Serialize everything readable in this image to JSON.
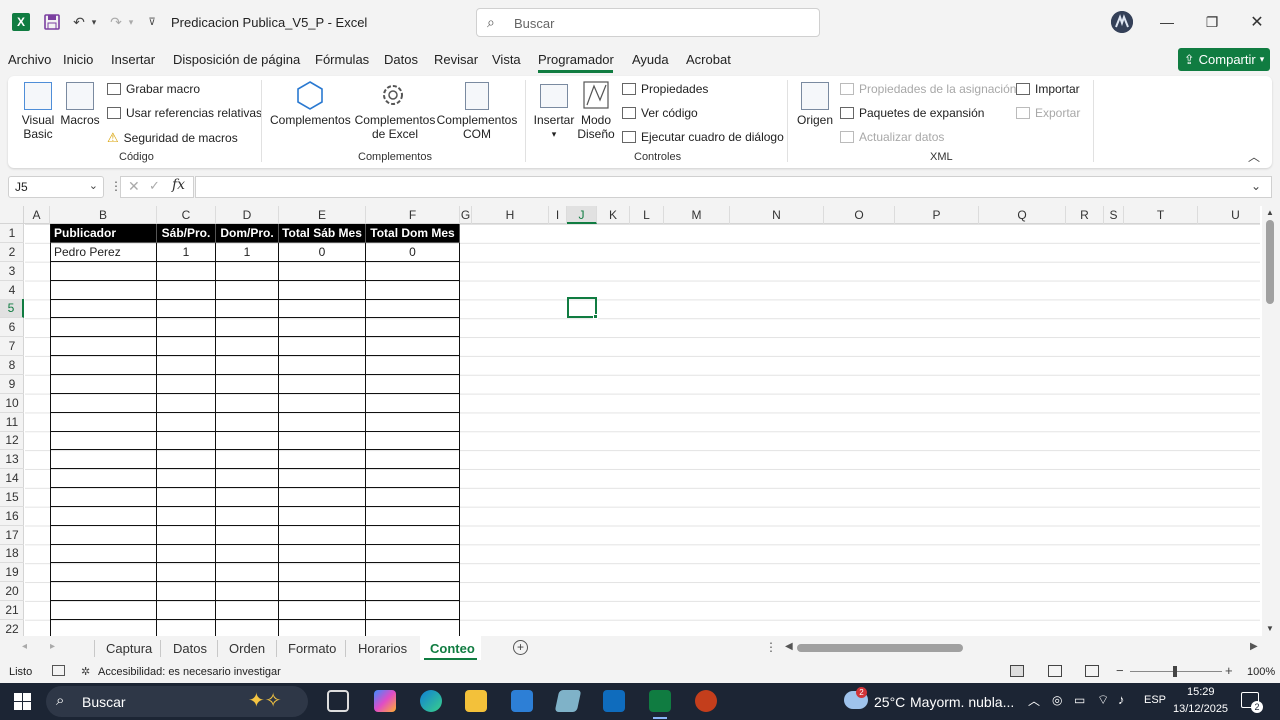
{
  "app": {
    "title": "Predicacion Publica_V5_P  -  Excel",
    "search_placeholder": "Buscar"
  },
  "menu": {
    "tabs": [
      "Archivo",
      "Inicio",
      "Insertar",
      "Disposición de página",
      "Fórmulas",
      "Datos",
      "Revisar",
      "Vista",
      "Programador",
      "Ayuda",
      "Acrobat"
    ],
    "active": "Programador",
    "share_label": "Compartir"
  },
  "ribbon": {
    "codigo": {
      "visual_basic": "Visual\nBasic",
      "macros": "Macros",
      "grabar_macro": "Grabar macro",
      "usar_referencias": "Usar referencias relativas",
      "seguridad": "Seguridad de macros",
      "group": "Código"
    },
    "complementos": {
      "complementos": "Complementos",
      "complementos_excel": "Complementos\nde Excel",
      "complementos_com": "Complementos\nCOM",
      "group": "Complementos"
    },
    "controles": {
      "insertar": "Insertar",
      "modo_diseno": "Modo\nDiseño",
      "propiedades": "Propiedades",
      "ver_codigo": "Ver código",
      "ejecutar": "Ejecutar cuadro de diálogo",
      "group": "Controles"
    },
    "xml": {
      "origen": "Origen",
      "propiedades_asignacion": "Propiedades de la asignación",
      "paquetes": "Paquetes de expansión",
      "actualizar": "Actualizar datos",
      "importar": "Importar",
      "exportar": "Exportar",
      "group": "XML"
    }
  },
  "formula_bar": {
    "name_box": "J5",
    "formula": ""
  },
  "columns": [
    "A",
    "B",
    "C",
    "D",
    "E",
    "F",
    "G",
    "H",
    "I",
    "J",
    "K",
    "L",
    "M",
    "N",
    "O",
    "P",
    "Q",
    "R",
    "S",
    "T",
    "U"
  ],
  "selected_column": "J",
  "selected_row": "5",
  "rows": [
    "1",
    "2",
    "3",
    "4",
    "5",
    "6",
    "7",
    "8",
    "9",
    "10",
    "11",
    "12",
    "13",
    "14",
    "15",
    "16",
    "17",
    "18",
    "19",
    "20",
    "21",
    "22"
  ],
  "table": {
    "headers": [
      "Publicador",
      "Sáb/Pro.",
      "Dom/Pro.",
      "Total Sáb Mes",
      "Total Dom Mes"
    ],
    "data": [
      [
        "Pedro Perez",
        "1",
        "1",
        "0",
        "0"
      ]
    ]
  },
  "sheet_tabs": [
    "Captura",
    "Datos",
    "Orden",
    "Formato",
    "Horarios",
    "Conteo"
  ],
  "active_sheet": "Conteo",
  "status": {
    "ready": "Listo",
    "accessibility": "Accesibilidad: es necesario investigar",
    "zoom": "100%"
  },
  "taskbar": {
    "search": "Buscar",
    "weather_temp": "25°C",
    "weather_desc": "Mayorm. nubla...",
    "weather_badge": "2",
    "lang": "ESP",
    "time": "15:29",
    "date": "13/12/2025",
    "notif_count": "2"
  }
}
